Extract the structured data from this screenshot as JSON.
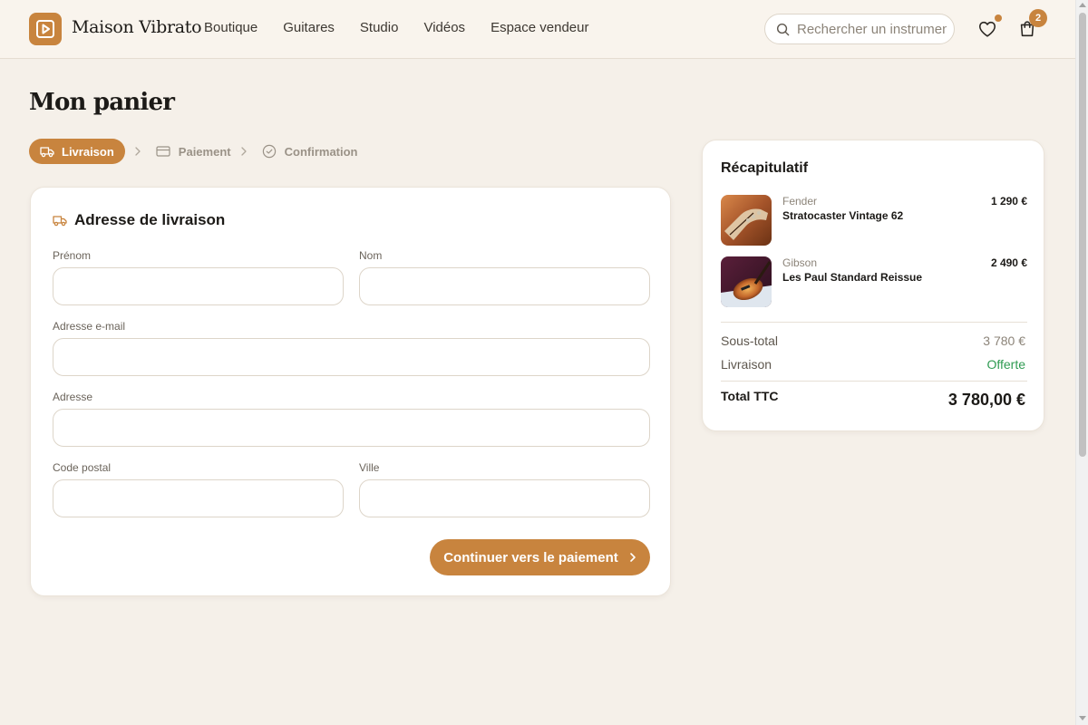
{
  "header": {
    "brand": "Maison Vibrato",
    "nav": [
      "Boutique",
      "Guitares",
      "Studio",
      "Vidéos",
      "Espace vendeur"
    ],
    "search_placeholder": "Rechercher un instrument",
    "cart_count": "2",
    "logo_icon": "play-square-icon",
    "accent_color": "#c8843e"
  },
  "page": {
    "title": "Mon panier"
  },
  "stepper": {
    "steps": [
      {
        "label": "Livraison",
        "icon": "truck-icon",
        "active": true
      },
      {
        "label": "Paiement",
        "icon": "credit-card-icon",
        "active": false
      },
      {
        "label": "Confirmation",
        "icon": "check-circle-icon",
        "active": false
      }
    ]
  },
  "form": {
    "title": "Adresse de livraison",
    "fields": {
      "first_name": {
        "label": "Prénom",
        "value": ""
      },
      "last_name": {
        "label": "Nom",
        "value": ""
      },
      "email": {
        "label": "Adresse e-mail",
        "value": ""
      },
      "address": {
        "label": "Adresse",
        "value": ""
      },
      "postal_code": {
        "label": "Code postal",
        "value": ""
      },
      "city": {
        "label": "Ville",
        "value": ""
      }
    },
    "submit_label": "Continuer vers le paiement"
  },
  "summary": {
    "title": "Récapitulatif",
    "items": [
      {
        "brand": "Fender",
        "name": "Stratocaster Vintage 62",
        "price": "1 290 €"
      },
      {
        "brand": "Gibson",
        "name": "Les Paul Standard Reissue",
        "price": "2 490 €"
      }
    ],
    "subtotal_label": "Sous-total",
    "subtotal_value": "3 780 €",
    "shipping_label": "Livraison",
    "shipping_value": "Offerte",
    "total_label": "Total TTC",
    "total_value": "3 780,00 €",
    "free_color": "#2f9b52"
  }
}
